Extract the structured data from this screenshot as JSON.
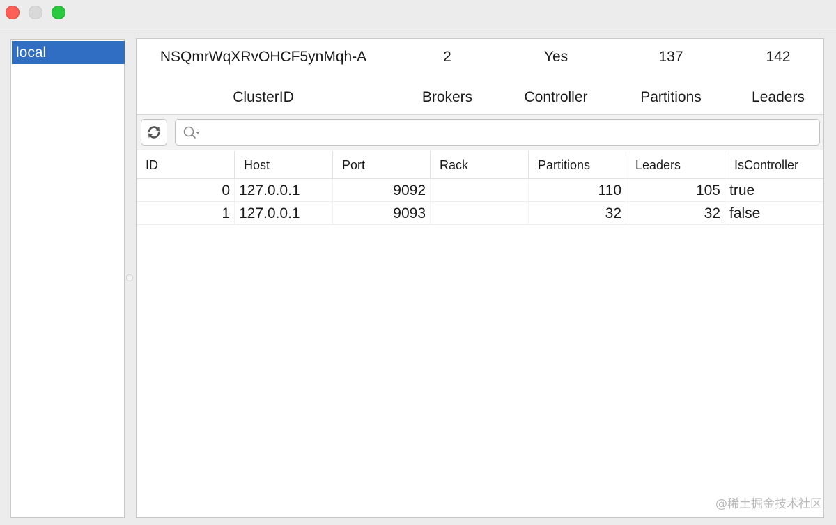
{
  "window": {
    "controls": [
      "close",
      "minimize",
      "maximize"
    ]
  },
  "sidebar": {
    "items": [
      {
        "label": "local",
        "selected": true
      }
    ]
  },
  "summary": {
    "cluster_id": "NSQmrWqXRvOHCF5ynMqh-A",
    "brokers": "2",
    "controller": "Yes",
    "partitions": "137",
    "leaders": "142",
    "labels": {
      "cluster_id": "ClusterID",
      "brokers": "Brokers",
      "controller": "Controller",
      "partitions": "Partitions",
      "leaders": "Leaders"
    }
  },
  "toolbar": {
    "refresh_icon": "refresh-icon",
    "search": {
      "value": "",
      "placeholder": "",
      "icon": "search-icon"
    }
  },
  "table": {
    "columns": [
      "ID",
      "Host",
      "Port",
      "Rack",
      "Partitions",
      "Leaders",
      "IsController"
    ],
    "rows": [
      {
        "id": "0",
        "host": "127.0.0.1",
        "port": "9092",
        "rack": "",
        "partitions": "110",
        "leaders": "105",
        "is_controller": "true"
      },
      {
        "id": "1",
        "host": "127.0.0.1",
        "port": "9093",
        "rack": "",
        "partitions": "32",
        "leaders": "32",
        "is_controller": "false"
      }
    ]
  },
  "watermark": "@稀土掘金技术社区",
  "colors": {
    "selection": "#2f6ec3",
    "close": "#fe5f57",
    "maximize": "#29c940"
  }
}
